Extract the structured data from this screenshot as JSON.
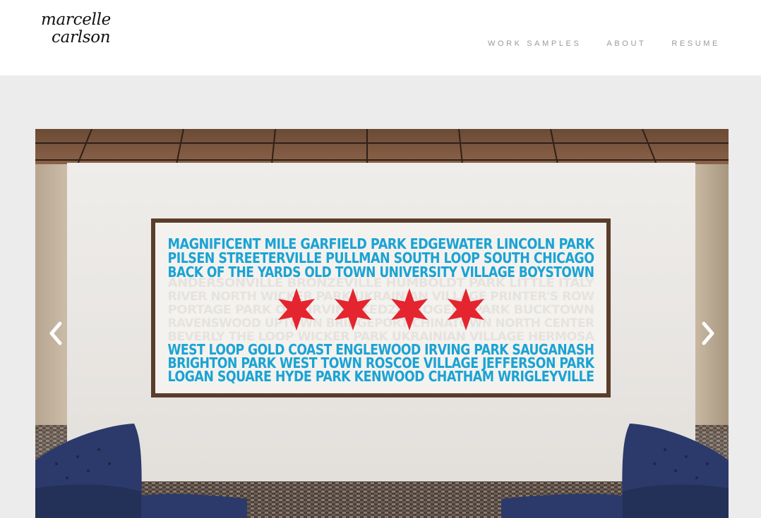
{
  "site": {
    "logo_line1": "marcelle",
    "logo_line2": "carlson"
  },
  "nav": {
    "items": [
      {
        "label": "WORK SAMPLES"
      },
      {
        "label": "ABOUT"
      },
      {
        "label": "RESUME"
      }
    ]
  },
  "slideshow": {
    "prev_icon": "chevron-left-icon",
    "next_icon": "chevron-right-icon",
    "artwork": {
      "top_lines": [
        "MAGNIFICENT MILE GARFIELD PARK EDGEWATER LINCOLN PARK",
        "PILSEN STREETERVILLE PULLMAN SOUTH LOOP SOUTH CHICAGO",
        "BACK OF THE YARDS OLD TOWN UNIVERSITY VILLAGE BOYSTOWN"
      ],
      "middle_lines": [
        "ANDERSONVILLE BRONZEVILLE HUMBOLDT PARK LITTLE ITALY",
        "RIVER NORTH WICKER PARK UKRAINIAN VILLAGE PRINTER'S ROW",
        "PORTAGE PARK OLD IRVING KEDZIE ROGERS PARK BUCKTOWN",
        "RAVENSWOOD UPTOWN BRIDGEPORT CHINATOWN NORTH CENTER",
        "BEVERLY THE LOOP WICKER PARK UKRAINIAN VILLAGE HERMOSA"
      ],
      "bottom_lines": [
        "WEST LOOP GOLD COAST ENGLEWOOD IRVING PARK SAUGANASH",
        "BRIGHTON PARK WEST TOWN ROSCOE VILLAGE JEFFERSON PARK",
        "LOGAN SQUARE HYDE PARK KENWOOD CHATHAM WRIGLEYVILLE"
      ]
    }
  },
  "colors": {
    "header_bg": "#ffffff",
    "page_bg": "#ececec",
    "nav_text": "#9a9a9a",
    "text_blue": "#1aa3d4",
    "star_red": "#e4252f",
    "chair_blue": "#2b3a6b",
    "frame_wood": "#5a3e2b"
  }
}
